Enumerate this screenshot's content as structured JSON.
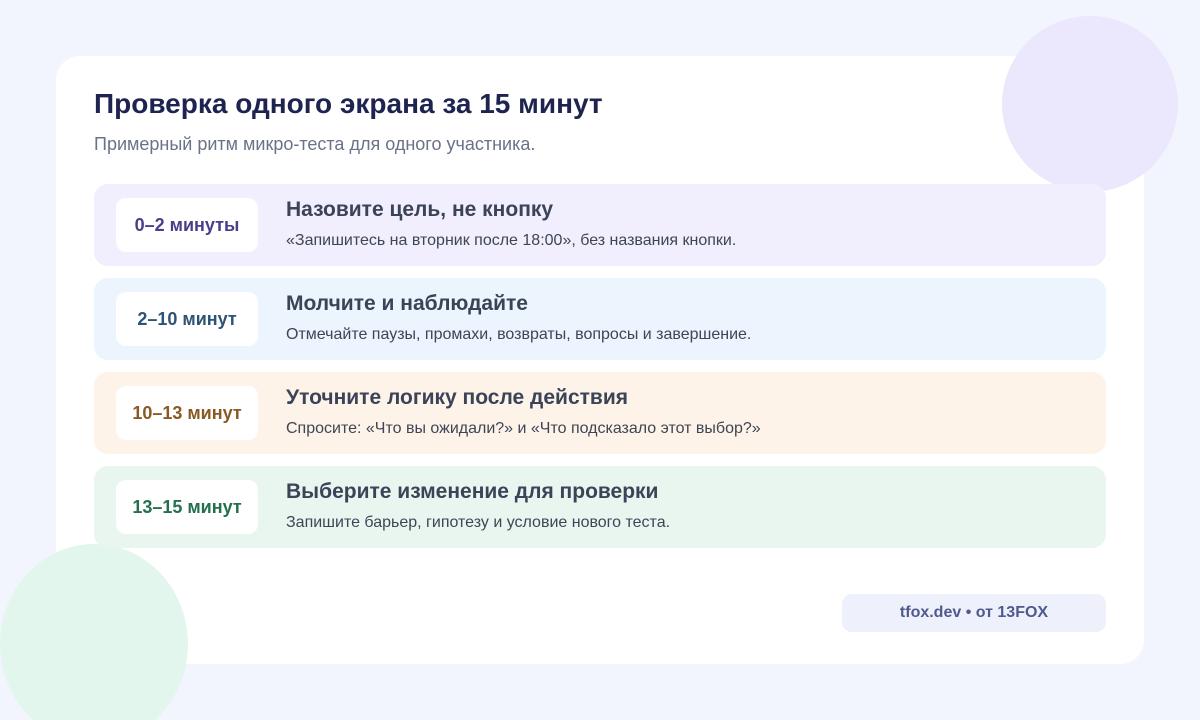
{
  "header": {
    "title": "Проверка одного экрана за 15 минут",
    "subtitle": "Примерный ритм микро-теста для одного участника."
  },
  "steps": [
    {
      "time": "0–2 минуты",
      "title": "Назовите цель, не кнопку",
      "description": "«Запишитесь на вторник после 18:00», без названия кнопки.",
      "background": "#f1eefd",
      "time_color": "#4b3d8a"
    },
    {
      "time": "2–10 минут",
      "title": "Молчите и наблюдайте",
      "description": "Отмечайте паузы, промахи, возвраты, вопросы и завершение.",
      "background": "#ecf4fd",
      "time_color": "#2f5376"
    },
    {
      "time": "10–13 минут",
      "title": "Уточните логику после действия",
      "description": "Спросите: «Что вы ожидали?» и «Что подсказало этот выбор?»",
      "background": "#fdf3e8",
      "time_color": "#8a5a24"
    },
    {
      "time": "13–15 минут",
      "title": "Выберите изменение для проверки",
      "description": "Запишите барьер, гипотезу и условие нового теста.",
      "background": "#e9f6ef",
      "time_color": "#24704e"
    }
  ],
  "footer": {
    "credit": "tfox.dev • от 13FOX"
  },
  "colors": {
    "page_background": "#f2f5fd",
    "card_background": "#ffffff",
    "title": "#1e2350",
    "decor_top": "#ebe7fc",
    "decor_bottom": "#e3f6ee"
  }
}
